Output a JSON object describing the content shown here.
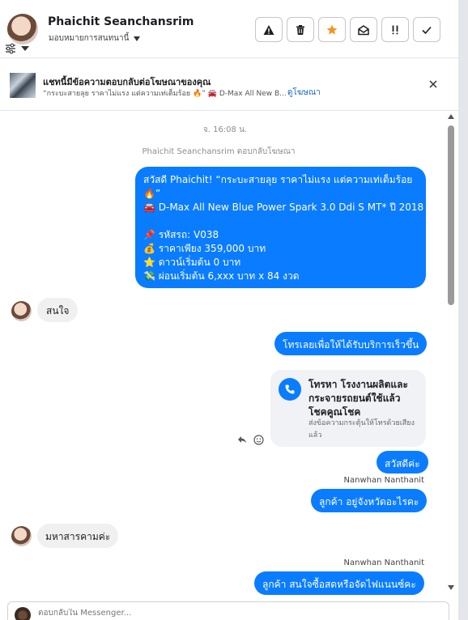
{
  "header": {
    "name": "Phaichit Seanchansrim",
    "assign_label": "มอบหมายการสนทนานี้",
    "toolbar_icons": [
      "warning-icon",
      "trash-icon",
      "star-icon",
      "mark-read-icon",
      "important-icon",
      "check-icon"
    ],
    "star_color": "#f7931e"
  },
  "ad_banner": {
    "title": "แชทนี้มีข้อความตอบกลับต่อโฆษณาของคุณ",
    "preview": "“กระบะสายลุย ราคาไม่แรง แต่ความเท่เต็มร้อย 🔥” 🚘 D-Max All New B...",
    "link": "ดูโฆษณา"
  },
  "conversation": {
    "timestamp": "จ. 16:08 น.",
    "reply_note": "Phaichit Seanchansrim ตอบกลับโฆษณา",
    "ad_message": {
      "lines": [
        "สวัสดี Phaichit! “กระบะสายลุย ราคาไม่แรง แต่ความเท่เต็มร้อย",
        "🔥”",
        "🚘 D-Max All New Blue Power Spark 3.0 Ddi S MT* ปี 2018",
        "",
        "📌 รหัสรถ: V038",
        "💰 ราคาเพียง 359,000 บาท",
        "⭐ ดาวน์เริ่มต้น 0 บาท",
        "💸 ผ่อนเริ่มต้น 6,xxx บาท x 84 งวด"
      ]
    },
    "msg_interested": "สนใจ",
    "msg_call_cta": "โทรเลยเพื่อให้ได้รับบริการเร็วขึ้น",
    "call_card": {
      "title": "โทรหา โรงงานผลิตและกระจายรถยนต์ใช้แล้ว โชคคูณโชค",
      "subtitle": "ส่งข้อความกระตุ้นให้โทรด้วยเสียงแล้ว"
    },
    "msg_hello": "สวัสดีค่ะ",
    "agent_name_1": "Nanwhan Nanthanit",
    "msg_province": "ลูกค้า อยู่จังหวัดอะไรคะ",
    "msg_mahasarakham": "มหาสารคามค่ะ",
    "agent_name_2": "Nanwhan Nanthanit",
    "msg_finance": "ลูกค้า สนใจซื้อสดหรือจัดไฟแนนซ์คะ"
  },
  "composer": {
    "placeholder": "ตอบกลับใน Messenger..."
  },
  "colors": {
    "outgoing_bubble": "#0a7cff",
    "incoming_bubble": "#f0f0f0"
  }
}
